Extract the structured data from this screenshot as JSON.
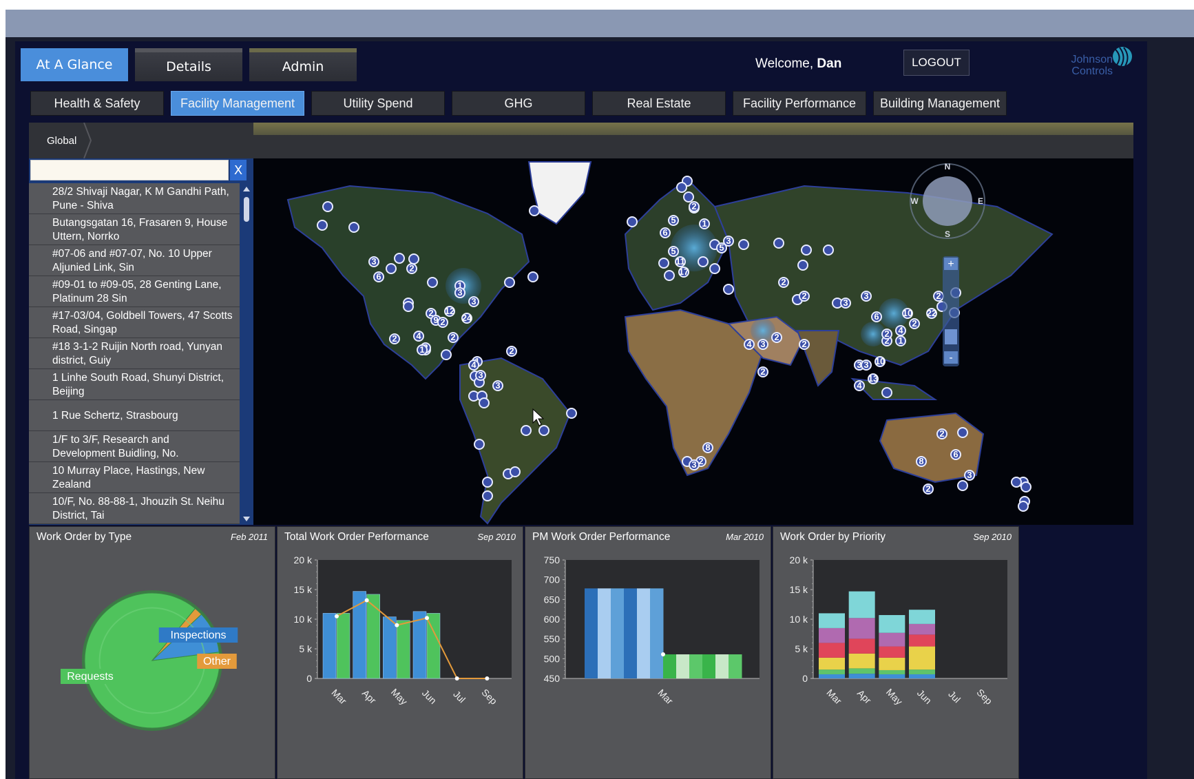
{
  "header": {
    "tabs": [
      {
        "label": "At A Glance",
        "active": true
      },
      {
        "label": "Details",
        "active": false
      },
      {
        "label": "Admin",
        "active": false
      }
    ],
    "welcome_prefix": "Welcome,",
    "user": "Dan",
    "logout": "LOGOUT",
    "logo_text": "Johnson Controls"
  },
  "subtabs": [
    {
      "label": "Health & Safety",
      "active": false
    },
    {
      "label": "Facility Management",
      "active": true
    },
    {
      "label": "Utility Spend",
      "active": false
    },
    {
      "label": "GHG",
      "active": false
    },
    {
      "label": "Real Estate",
      "active": false
    },
    {
      "label": "Facility Performance",
      "active": false
    },
    {
      "label": "Building Management",
      "active": false
    }
  ],
  "breadcrumb": "Global",
  "search": {
    "value": "",
    "clear": "X"
  },
  "locations": [
    "28/2 Shivaji Nagar, K M Gandhi Path, Pune - Shiva",
    "Butangsgatan 16, Frasaren 9, House Uttern, Norrko",
    "#07-06 and #07-07, No. 10 Upper Aljunied Link, Sin",
    "#09-01 to #09-05, 28 Genting Lane, Platinum 28 Sin",
    "#17-03/04, Goldbell Towers, 47 Scotts Road, Singap",
    "#18 3-1-2 Ruijin North road, Yunyan district, Guiy",
    "1 Linhe South Road, Shunyi District, Beijing",
    "1 Rue Schertz, Strasbourg",
    "1/F to 3/F, Research and Development Buidling, No.",
    "10 Murray Place, Hastings, New Zealand",
    "10/F, No. 88-88-1, Jhouzih St. Neihu District, Tai"
  ],
  "map": {
    "compass": [
      "N",
      "E",
      "S",
      "W"
    ],
    "zoom_in": "+",
    "zoom_out": "-",
    "cluster_labels": [
      "3",
      "6",
      "2",
      "16",
      "2",
      "1",
      "9",
      "2",
      "4",
      "2",
      "12",
      "24",
      "3",
      "2",
      "1",
      "2",
      "2",
      "3",
      "1",
      "4",
      "3",
      "3",
      "3",
      "5",
      "2",
      "1",
      "5",
      "11",
      "6",
      "17",
      "2",
      "4",
      "3",
      "2",
      "2",
      "2",
      "22",
      "2",
      "1",
      "2",
      "10",
      "3",
      "4",
      "10",
      "2",
      "4",
      "6",
      "3",
      "13",
      "2",
      "8",
      "3",
      "2",
      "6",
      "8",
      "2",
      "3",
      "3",
      "2",
      "2",
      "3",
      "5"
    ]
  },
  "colors": {
    "active_tab": "#4a8edb",
    "panel": "#545558",
    "plot_bg": "#2a2b2e",
    "line": "#e39a3b"
  },
  "chart_data": [
    {
      "type": "pie",
      "title": "Work Order by Type",
      "date": "Feb 2011",
      "categories": [
        "Requests",
        "Inspections",
        "Other"
      ],
      "values": [
        88,
        10,
        2
      ],
      "colors": [
        "#4fc35c",
        "#3f8fd6",
        "#e39a3b"
      ]
    },
    {
      "type": "bar",
      "title": "Total Work Order Performance",
      "date": "Sep 2010",
      "categories": [
        "Mar",
        "Apr",
        "May",
        "Jun",
        "Jul",
        "Sep"
      ],
      "ylim": [
        0,
        20000
      ],
      "yticks": [
        "20 k",
        "15 k",
        "10 k",
        "5 k",
        "0"
      ],
      "series": [
        {
          "type": "bar",
          "color": "#3f8fd6",
          "values": [
            11000,
            14700,
            10400,
            11300,
            0,
            0
          ]
        },
        {
          "type": "bar",
          "color": "#4fc35c",
          "values": [
            11000,
            14200,
            9800,
            11000,
            0,
            0
          ]
        },
        {
          "type": "line",
          "color": "#e39a3b",
          "values": [
            10500,
            13200,
            9000,
            10200,
            0,
            0
          ]
        }
      ]
    },
    {
      "type": "bar",
      "title": "PM Work Order Performance",
      "date": "Mar 2010",
      "categories": [
        "Mar"
      ],
      "ylim": [
        450,
        750
      ],
      "yticks": [
        "750",
        "700",
        "650",
        "600",
        "550",
        "500",
        "450"
      ],
      "series": [
        {
          "type": "bar",
          "color": "#3f8fd6",
          "values": [
            678
          ]
        },
        {
          "type": "bar",
          "color": "#4fc35c",
          "values": [
            511
          ]
        }
      ]
    },
    {
      "type": "bar",
      "title": "Work Order by Priority",
      "date": "Sep 2010",
      "categories": [
        "Mar",
        "Apr",
        "May",
        "Jun",
        "Jul",
        "Sep"
      ],
      "ylim": [
        0,
        20000
      ],
      "yticks": [
        "20 k",
        "15 k",
        "10 k",
        "5 k",
        "0"
      ],
      "stacked": true,
      "series": [
        {
          "color": "#3f8fd6",
          "values": [
            700,
            800,
            700,
            700,
            0,
            0
          ]
        },
        {
          "color": "#5fc46b",
          "values": [
            800,
            900,
            700,
            800,
            0,
            0
          ]
        },
        {
          "color": "#e9d24a",
          "values": [
            2000,
            2500,
            2100,
            3900,
            0,
            0
          ]
        },
        {
          "color": "#e0455a",
          "values": [
            2500,
            2500,
            1900,
            2000,
            0,
            0
          ]
        },
        {
          "color": "#b06ab0",
          "values": [
            2500,
            3500,
            2300,
            1800,
            0,
            0
          ]
        },
        {
          "color": "#7fd6d8",
          "values": [
            2500,
            4500,
            3000,
            2400,
            0,
            0
          ]
        }
      ]
    }
  ]
}
